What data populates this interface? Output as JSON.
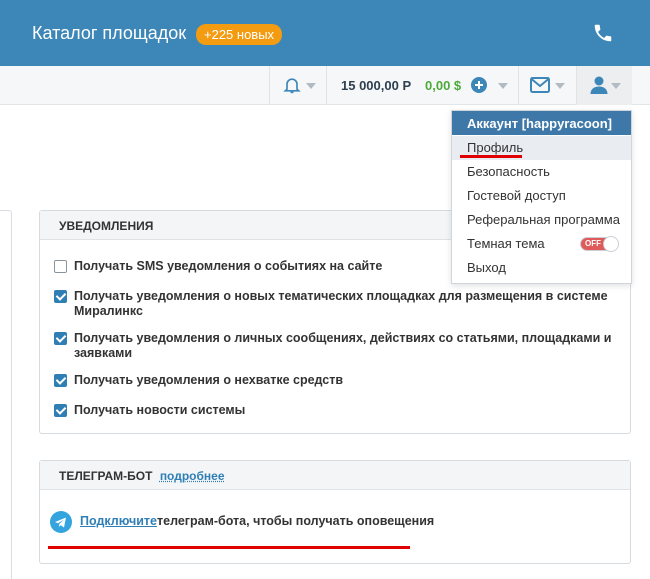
{
  "header": {
    "title": "Каталог площадок",
    "new_badge": "+225 новых",
    "phone_icon": "phone-icon"
  },
  "toolbar": {
    "bell_icon": "bell-icon",
    "balance_rub": "15 000,00 Р",
    "balance_usd": "0,00 $",
    "add_funds_icon": "plus-circle-icon",
    "mail_icon": "envelope-icon",
    "user_icon": "user-icon"
  },
  "account_menu": {
    "header": "Аккаунт [happyracoon]",
    "items": [
      {
        "label": "Профиль",
        "highlighted": true
      },
      {
        "label": "Безопасность"
      },
      {
        "label": "Гостевой доступ"
      },
      {
        "label": "Реферальная программа"
      },
      {
        "label": "Темная тема",
        "toggle": "OFF"
      },
      {
        "label": "Выход"
      }
    ]
  },
  "notifications": {
    "heading": "УВЕДОМЛЕНИЯ",
    "options": [
      {
        "checked": false,
        "line1": "Получать SMS уведомления о событиях на сайте"
      },
      {
        "checked": true,
        "line1": "Получать уведомления о новых тематических площадках для размещения в системе",
        "line2": "Миралинкс"
      },
      {
        "checked": true,
        "line1": "Получать уведомления о личных сообщениях, действиях со статьями, площадками и",
        "line2": "заявками"
      },
      {
        "checked": true,
        "line1": "Получать уведомления о нехватке средств"
      },
      {
        "checked": true,
        "line1": "Получать новости системы"
      }
    ]
  },
  "telegram": {
    "heading": "ТЕЛЕГРАМ-БОТ",
    "more_link": "подробнее",
    "connect_link": "Подключите",
    "connect_text": "телеграм-бота, чтобы получать оповещения"
  },
  "colors": {
    "header_bg": "#3d87b8",
    "badge": "#f39c12",
    "accent": "#2f7fb5",
    "annotation_red": "#e00000"
  }
}
